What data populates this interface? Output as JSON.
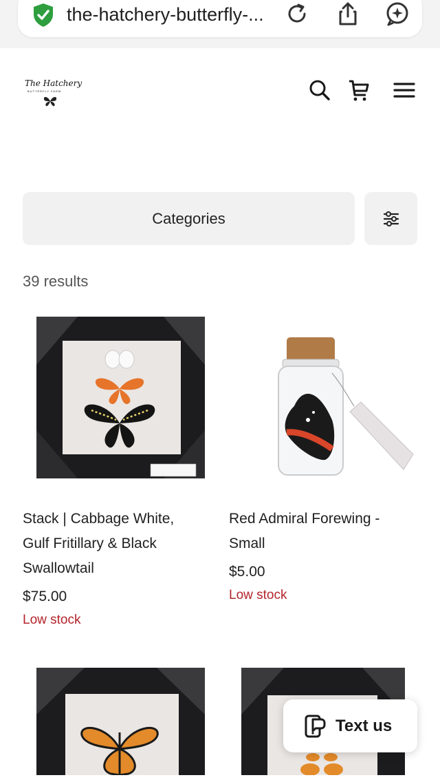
{
  "browser": {
    "url": "the-hatchery-butterfly-...",
    "icons": [
      "shield-check-icon",
      "reload-icon",
      "share-icon",
      "ai-assistant-icon"
    ]
  },
  "site": {
    "logo_name": "The Hatchery",
    "logo_sub": "BUTTERFLY FARM",
    "header_icons": [
      "search-icon",
      "cart-icon",
      "menu-icon"
    ]
  },
  "filters": {
    "categories_label": "Categories",
    "filter_icon": "sliders-icon"
  },
  "results": {
    "count_label": "39 results"
  },
  "products": [
    {
      "title_lines": [
        "Stack | Cabbage White,",
        "Gulf Fritillary & Black",
        "Swallowtail"
      ],
      "price": "$75.00",
      "stock": "Low stock"
    },
    {
      "title_lines": [
        "Red Admiral Forewing -",
        "Small"
      ],
      "price": "$5.00",
      "stock": "Low stock"
    },
    {
      "title_lines": [],
      "price": "",
      "stock": ""
    },
    {
      "title_lines": [],
      "price": "",
      "stock": ""
    }
  ],
  "chat": {
    "label": "Text us",
    "icon": "chat-phone-icon"
  },
  "colors": {
    "stock_red": "#b3242b",
    "shield_green": "#2e9e3f",
    "chip_bg": "#f1f1f1"
  }
}
